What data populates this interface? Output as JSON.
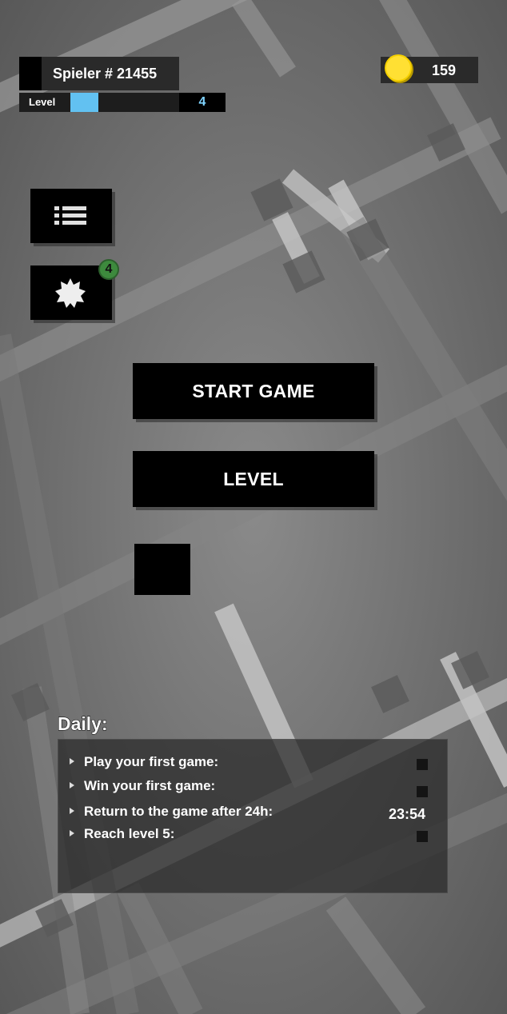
{
  "player": {
    "name": "Spieler # 21455"
  },
  "level": {
    "label": "Level",
    "value": "4",
    "progress": 0.26
  },
  "coins": {
    "value": "159"
  },
  "side_menu": {
    "notification_count": "4"
  },
  "main_menu": {
    "start_label": "START GAME",
    "level_label": "LEVEL"
  },
  "daily": {
    "title": "Daily:",
    "tasks": [
      {
        "label": "Play your first game:"
      },
      {
        "label": "Win your first game:"
      },
      {
        "label": "Return to the game after 24h:",
        "timer": "23:54"
      },
      {
        "label": "Reach level 5:"
      }
    ]
  },
  "colors": {
    "accent": "#62c1f1",
    "coin": "#f5d000",
    "badge": "#3d8a3d"
  }
}
